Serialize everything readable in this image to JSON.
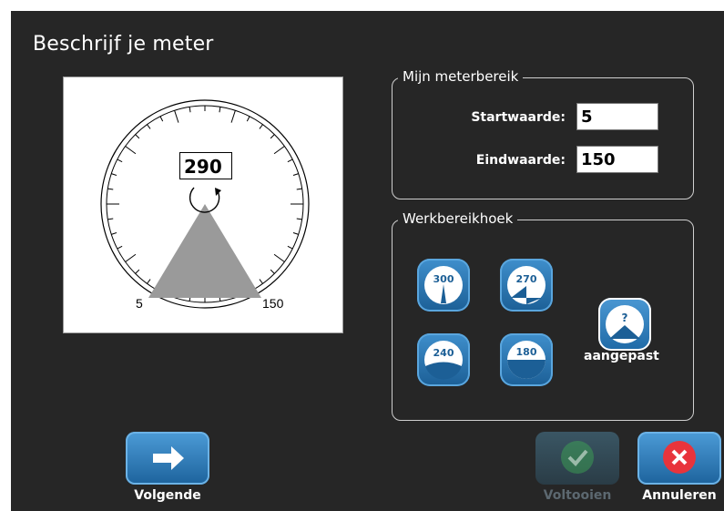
{
  "dialog": {
    "title": "Beschrijf je meter"
  },
  "preview": {
    "value": "290",
    "start_label": "5",
    "end_label": "150"
  },
  "range_group": {
    "title": "Mijn meterbereik",
    "start_label": "Startwaarde:",
    "start_value": "5",
    "end_label": "Eindwaarde:",
    "end_value": "150"
  },
  "angle_group": {
    "title": "Werkbereikhoek",
    "options": [
      "300",
      "270",
      "240",
      "180"
    ],
    "custom_symbol": "?",
    "custom_label": "aangepast"
  },
  "buttons": {
    "next": "Volgende",
    "finish": "Voltooien",
    "cancel": "Annuleren"
  },
  "colors": {
    "background": "#262626",
    "accent": "#2c7bbf",
    "cancel_icon": "#e8343c",
    "finish_icon": "#3fae55",
    "gauge_wedge": "#9a9a9a"
  }
}
